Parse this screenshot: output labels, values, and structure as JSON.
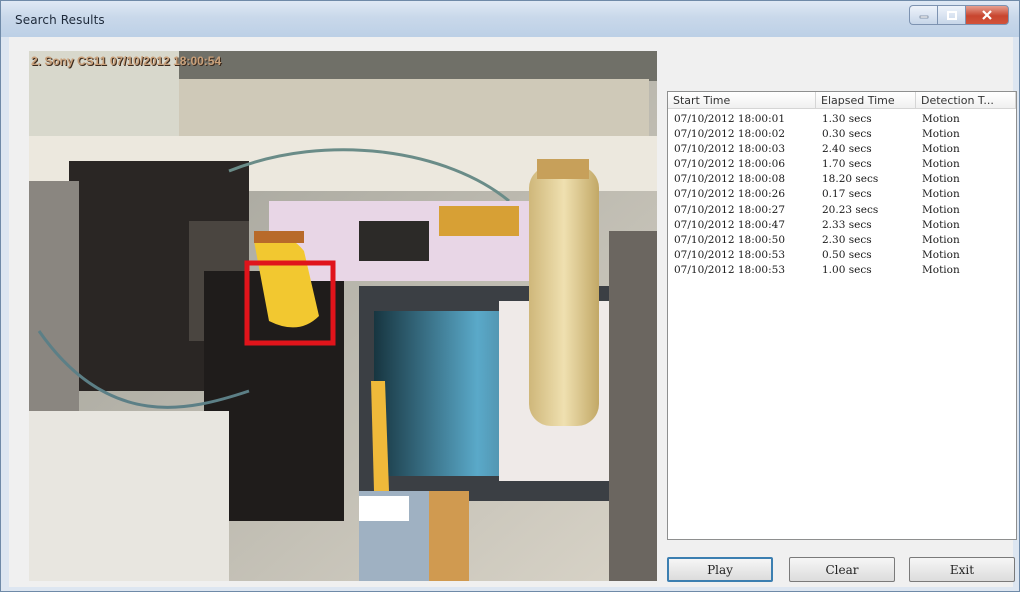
{
  "window": {
    "title": "Search Results"
  },
  "video": {
    "camera_label": "2. Sony CS11 07/10/2012 18:00:54"
  },
  "results": {
    "columns": [
      "Start Time",
      "Elapsed Time",
      "Detection T..."
    ],
    "rows": [
      [
        "07/10/2012 18:00:01",
        "1.30 secs",
        "Motion"
      ],
      [
        "07/10/2012 18:00:02",
        "0.30 secs",
        "Motion"
      ],
      [
        "07/10/2012 18:00:03",
        "2.40 secs",
        "Motion"
      ],
      [
        "07/10/2012 18:00:06",
        "1.70 secs",
        "Motion"
      ],
      [
        "07/10/2012 18:00:08",
        "18.20 secs",
        "Motion"
      ],
      [
        "07/10/2012 18:00:26",
        "0.17 secs",
        "Motion"
      ],
      [
        "07/10/2012 18:00:27",
        "20.23 secs",
        "Motion"
      ],
      [
        "07/10/2012 18:00:47",
        "2.33 secs",
        "Motion"
      ],
      [
        "07/10/2012 18:00:50",
        "2.30 secs",
        "Motion"
      ],
      [
        "07/10/2012 18:00:53",
        "0.50 secs",
        "Motion"
      ],
      [
        "07/10/2012 18:00:53",
        "1.00 secs",
        "Motion"
      ]
    ]
  },
  "buttons": {
    "play": "Play",
    "clear": "Clear",
    "exit": "Exit"
  },
  "colors": {
    "detection_box": "#e0141b",
    "accent_focus": "#3c7fb1"
  }
}
